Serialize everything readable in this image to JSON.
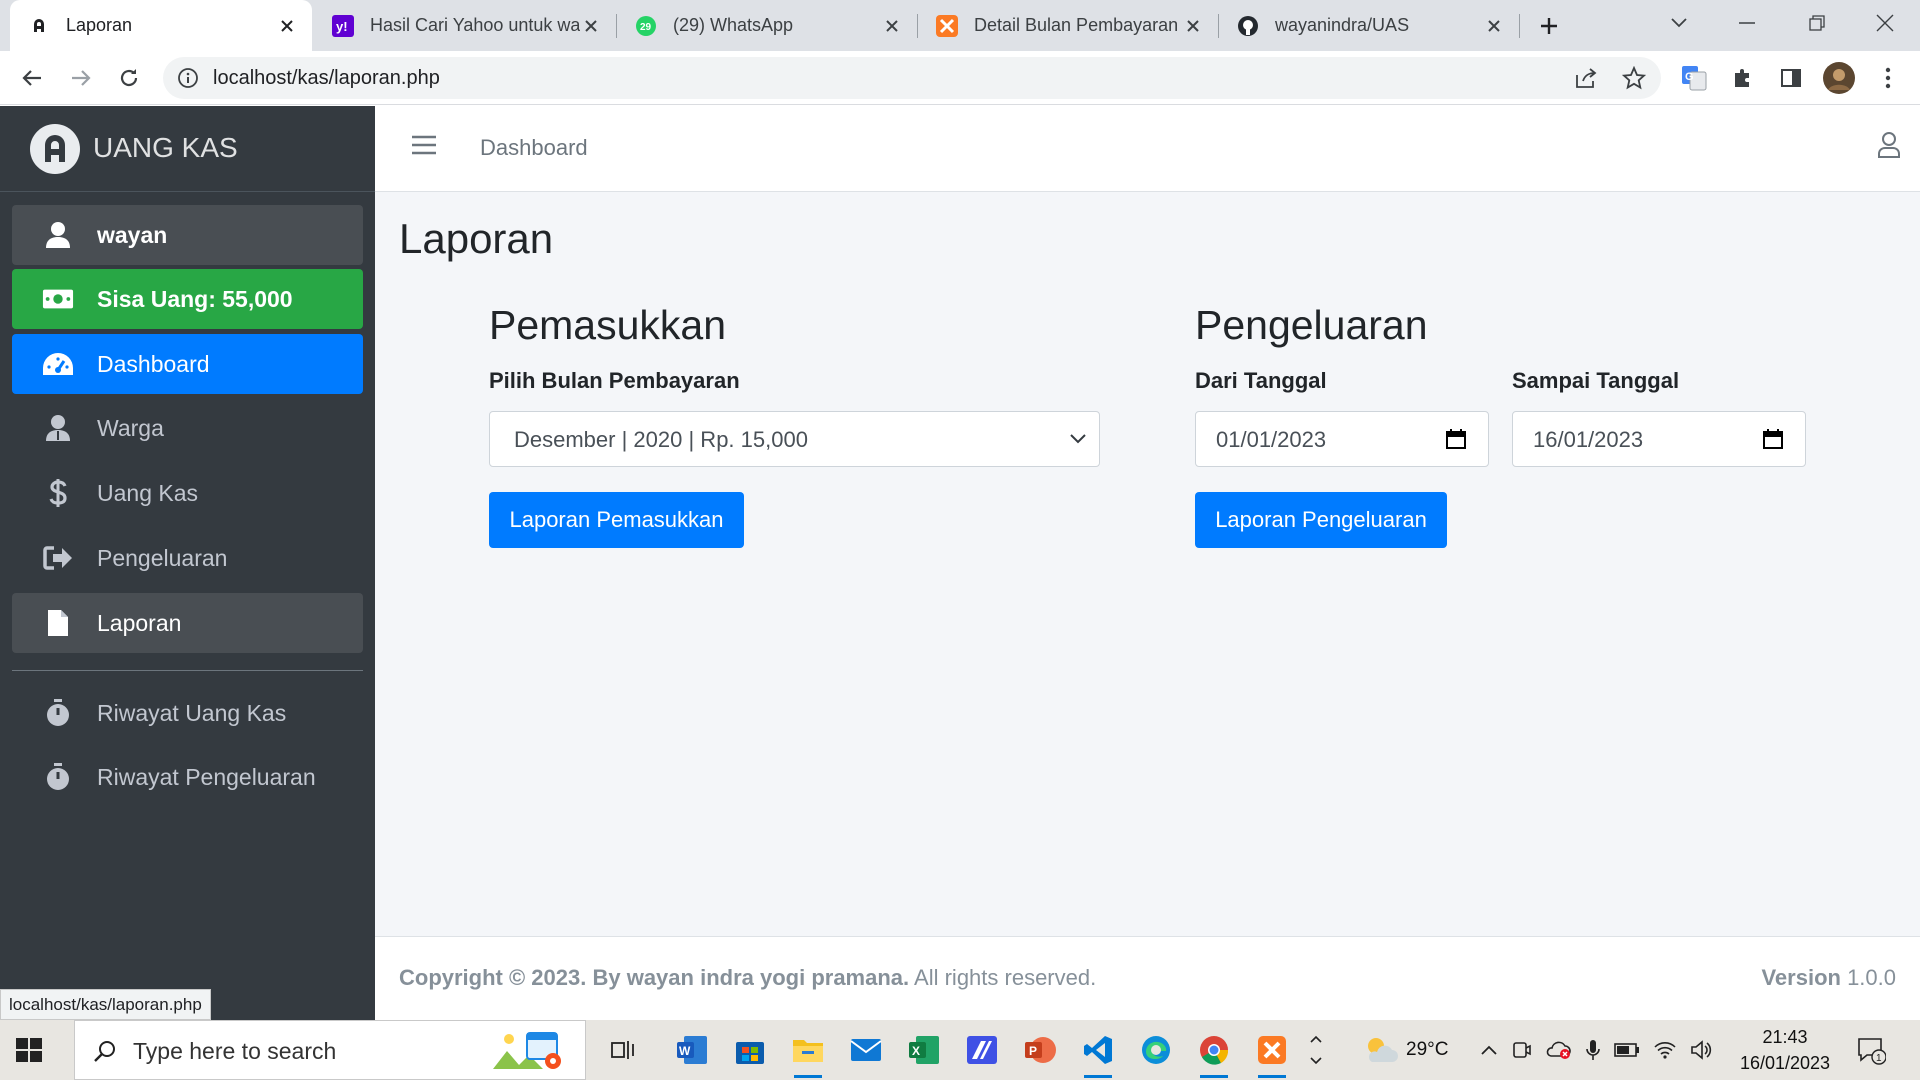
{
  "browser": {
    "tabs": [
      {
        "label": "Laporan",
        "icon": "adminlte-icon",
        "active": true
      },
      {
        "label": "Hasil Cari Yahoo untuk wa",
        "icon": "yahoo-icon",
        "active": false
      },
      {
        "label": "(29) WhatsApp",
        "icon": "whatsapp-icon",
        "active": false
      },
      {
        "label": "Detail Bulan Pembayaran",
        "icon": "xampp-icon",
        "active": false
      },
      {
        "label": "wayanindra/UAS",
        "icon": "github-icon",
        "active": false
      }
    ],
    "url": "localhost/kas/laporan.php",
    "status_url": "localhost/kas/laporan.php",
    "whatsapp_badge": "29"
  },
  "sidebar": {
    "brand": "UANG KAS",
    "items": [
      {
        "label": "wayan",
        "icon": "user-icon"
      },
      {
        "label": "Sisa Uang: 55,000",
        "icon": "money-icon"
      },
      {
        "label": "Dashboard",
        "icon": "tachometer-icon"
      },
      {
        "label": "Warga",
        "icon": "user-group-icon"
      },
      {
        "label": "Uang Kas",
        "icon": "dollar-icon"
      },
      {
        "label": "Pengeluaran",
        "icon": "sign-out-icon"
      },
      {
        "label": "Laporan",
        "icon": "file-icon"
      },
      {
        "label": "Riwayat Uang Kas",
        "icon": "stopwatch-icon"
      },
      {
        "label": "Riwayat Pengeluaran",
        "icon": "stopwatch-icon"
      }
    ]
  },
  "topnav": {
    "breadcrumb": "Dashboard"
  },
  "page": {
    "title": "Laporan",
    "pemasukkan": {
      "heading": "Pemasukkan",
      "select_label": "Pilih Bulan Pembayaran",
      "select_value": "Desember | 2020 | Rp. 15,000",
      "button": "Laporan Pemasukkan"
    },
    "pengeluaran": {
      "heading": "Pengeluaran",
      "from_label": "Dari Tanggal",
      "from_value": "01/01/2023",
      "to_label": "Sampai Tanggal",
      "to_value": "16/01/2023",
      "button": "Laporan Pengeluaran"
    }
  },
  "footer": {
    "copyright_bold": "Copyright © 2023. By wayan indra yogi pramana.",
    "copyright_rest": " All rights reserved.",
    "version_label": "Version",
    "version_value": " 1.0.0"
  },
  "taskbar": {
    "search_placeholder": "Type here to search",
    "temperature": "29°C",
    "time": "21:43",
    "date": "16/01/2023",
    "notification_count": "1"
  },
  "colors": {
    "primary": "#007bff",
    "success": "#28a745",
    "sidebar_bg": "#343a40",
    "content_bg": "#f4f6f9"
  }
}
